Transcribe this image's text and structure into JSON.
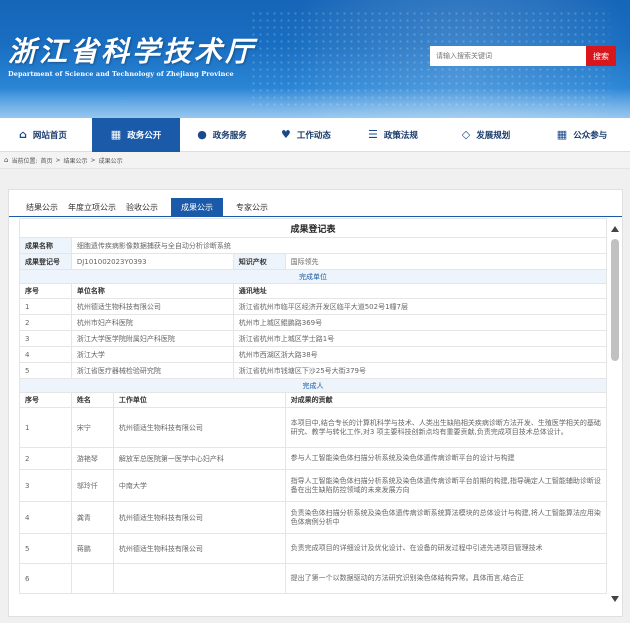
{
  "header": {
    "logo_cn": "浙江省科学技术厅",
    "logo_en": "Department of Science and Technology of Zhejiang Province",
    "search_placeholder": "请输入搜索关键词",
    "search_button": "搜索"
  },
  "nav": {
    "items": [
      {
        "label": "网站首页",
        "icon": "home-icon"
      },
      {
        "label": "政务公开",
        "icon": "grid-icon"
      },
      {
        "label": "政务服务",
        "icon": "chat-icon"
      },
      {
        "label": "工作动态",
        "icon": "heart-icon"
      },
      {
        "label": "政策法规",
        "icon": "list-icon"
      },
      {
        "label": "发展规划",
        "icon": "handshake-icon"
      },
      {
        "label": "公众参与",
        "icon": "people-icon"
      }
    ],
    "active_index": 1
  },
  "breadcrumb": {
    "prefix": "当前位置:",
    "items": [
      "首页",
      "结果公示",
      "成果公示"
    ],
    "sep": ">"
  },
  "tabs": [
    "结果公示",
    "年度立项公示",
    "验收公示",
    "成果公示",
    "专家公示"
  ],
  "active_tab": 3,
  "record": {
    "title": "成果登记表",
    "name_label": "成果名称",
    "name_value": "细胞遗传疾病影像数据捕获与全自动分析诊断系统",
    "reg_label": "成果登记号",
    "reg_value": "DJ101002023Y0393",
    "ip_label": "知识产权",
    "ip_value": "国际领先"
  },
  "units": {
    "section": "完成单位",
    "headers": [
      "序号",
      "单位名称",
      "通讯地址"
    ],
    "rows": [
      [
        "1",
        "杭州德适生物科技有限公司",
        "浙江省杭州市临平区经济开发区临平大道502号1幢7层"
      ],
      [
        "2",
        "杭州市妇产科医院",
        "杭州市上城区鲲鹏路369号"
      ],
      [
        "3",
        "浙江大学医学院附属妇产科医院",
        "浙江省杭州市上城区学士路1号"
      ],
      [
        "4",
        "浙江大学",
        "杭州市西湖区浙大路38号"
      ],
      [
        "5",
        "浙江省医疗器械检验研究院",
        "浙江省杭州市钱塘区下沙25号大街379号"
      ]
    ]
  },
  "people": {
    "section": "完成人",
    "headers": [
      "序号",
      "姓名",
      "工作单位",
      "对成果的贡献"
    ],
    "rows": [
      [
        "1",
        "宋宁",
        "杭州德适生物科技有限公司",
        "本项目中,结合专长的计算机科学与技术、人类出生缺陷相关疾病诊断方法开发、生殖医学相关的基础研究、教学与转化工作,对3 项主要科技创新点均有重要贡献,负责完成项目技术总体设计。"
      ],
      [
        "2",
        "游艳琴",
        "解放军总医院第一医学中心妇产科",
        "参与人工智能染色体扫描分析系统及染色体遗传病诊断平台的设计与构建"
      ],
      [
        "3",
        "邬玲仟",
        "中南大学",
        "指导人工智能染色体扫描分析系统及染色体遗传病诊断平台前期的构建,指导确定人工智能辅助诊断设备在出生缺陷防控领域的未来发展方向"
      ],
      [
        "4",
        "龚青",
        "杭州德适生物科技有限公司",
        "负责染色体扫描分析系统及染色体遗传病诊断系统算法模块的总体设计与构建,将人工智能算法应用染色体病例分析中"
      ],
      [
        "5",
        "蒋鹏",
        "杭州德适生物科技有限公司",
        "负责完成项目的详细设计及优化设计、在设备的研发过程中引进先进项目管理技术"
      ],
      [
        "6",
        "",
        "",
        "提出了第一个以数据驱动的方法研究识别染色体结构异常。具体而言,结合正"
      ]
    ]
  }
}
